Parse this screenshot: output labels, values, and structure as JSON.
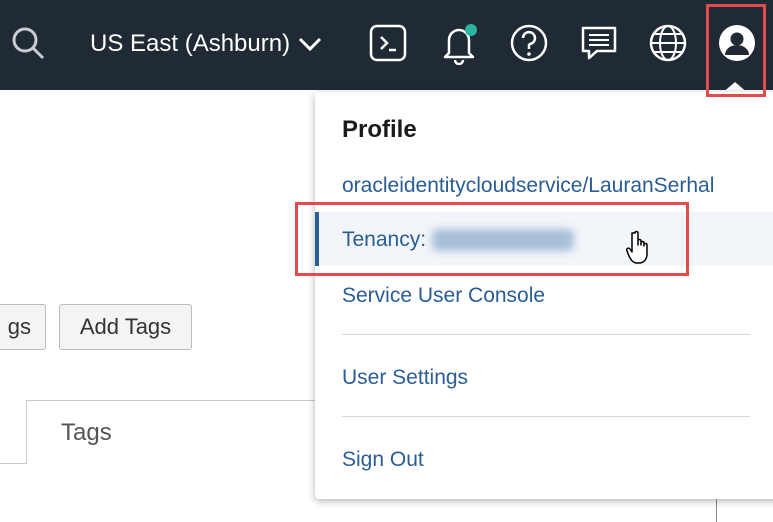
{
  "header": {
    "region_label": "US East (Ashburn)",
    "icons": [
      "search-icon",
      "chevron-down-icon",
      "cloud-shell-icon",
      "bell-icon",
      "help-icon",
      "chat-icon",
      "globe-icon",
      "profile-icon"
    ],
    "notification_dot_color": "#2bb5a0",
    "background_color": "#1f2a35"
  },
  "page": {
    "buttons": {
      "manage_tags_partial": "gs",
      "add_tags": "Add Tags"
    },
    "tabs": {
      "tags": "Tags"
    }
  },
  "profile_menu": {
    "title": "Profile",
    "username": "oracleidentitycloudservice/LauranSerhal",
    "tenancy_label": "Tenancy:",
    "service_user_console": "Service User Console",
    "user_settings": "User Settings",
    "sign_out": "Sign Out",
    "link_color": "#2a5d96"
  },
  "annotations": {
    "highlight_color": "#e34a4a"
  }
}
